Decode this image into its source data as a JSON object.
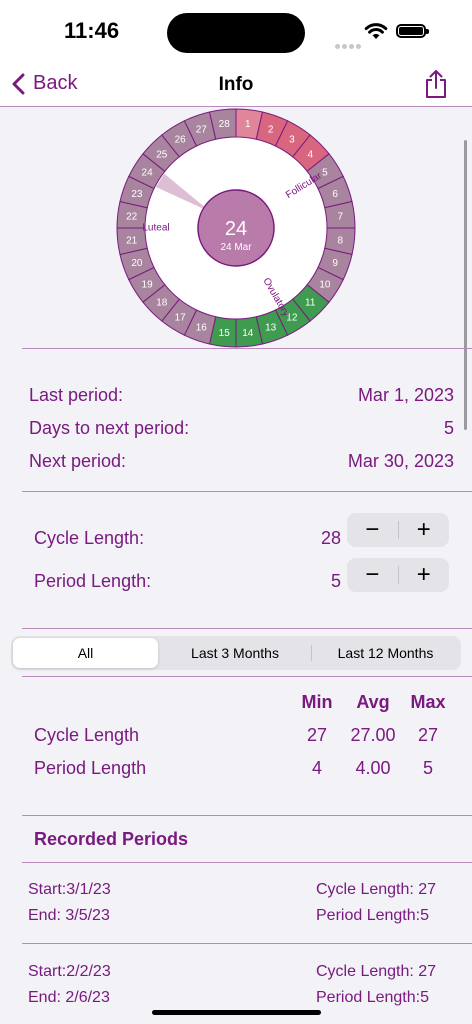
{
  "status": {
    "time": "11:46"
  },
  "nav": {
    "back_label": "Back",
    "title": "Info"
  },
  "wheel": {
    "center_day": "24",
    "center_date": "24 Mar",
    "labels": {
      "follicular": "Follicular",
      "ovulatory": "Ovulatory",
      "luteal": "Luteal"
    },
    "days": [
      "1",
      "2",
      "3",
      "4",
      "5",
      "6",
      "7",
      "8",
      "9",
      "10",
      "11",
      "12",
      "13",
      "14",
      "15",
      "16",
      "17",
      "18",
      "19",
      "20",
      "21",
      "22",
      "23",
      "24",
      "25",
      "26",
      "27",
      "28"
    ],
    "period_days": 4,
    "fertile_days": [
      "11",
      "12",
      "13",
      "14",
      "15"
    ],
    "current_day": 24,
    "colors": {
      "period": "#d9667f",
      "period_first": "#e0869a",
      "fertile": "#3e9b4f",
      "normal": "#a8849e",
      "border": "#7a1a80",
      "center": "#b97ba9"
    }
  },
  "summary": {
    "last_period_label": "Last period:",
    "last_period_value": "Mar 1, 2023",
    "days_to_next_label": "Days to next period:",
    "days_to_next_value": "5",
    "next_period_label": "Next period:",
    "next_period_value": "Mar 30, 2023"
  },
  "settings": {
    "cycle_length_label": "Cycle Length:",
    "cycle_length_value": "28",
    "period_length_label": "Period Length:",
    "period_length_value": "5",
    "minus": "−",
    "plus": "+"
  },
  "filter": {
    "options": [
      "All",
      "Last 3 Months",
      "Last 12 Months"
    ],
    "selected": "All"
  },
  "stats": {
    "headers": [
      "Min",
      "Avg",
      "Max"
    ],
    "rows": [
      {
        "label": "Cycle Length",
        "min": "27",
        "avg": "27.00",
        "max": "27"
      },
      {
        "label": "Period Length",
        "min": "4",
        "avg": "4.00",
        "max": "5"
      }
    ]
  },
  "recorded": {
    "title": "Recorded Periods",
    "entries": [
      {
        "start": "Start:3/1/23",
        "end": "End:  3/5/23",
        "cycle": "Cycle Length:  27",
        "period": "Period Length:5"
      },
      {
        "start": "Start:2/2/23",
        "end": "End:  2/6/23",
        "cycle": "Cycle Length:  27",
        "period": "Period Length:5"
      }
    ]
  }
}
